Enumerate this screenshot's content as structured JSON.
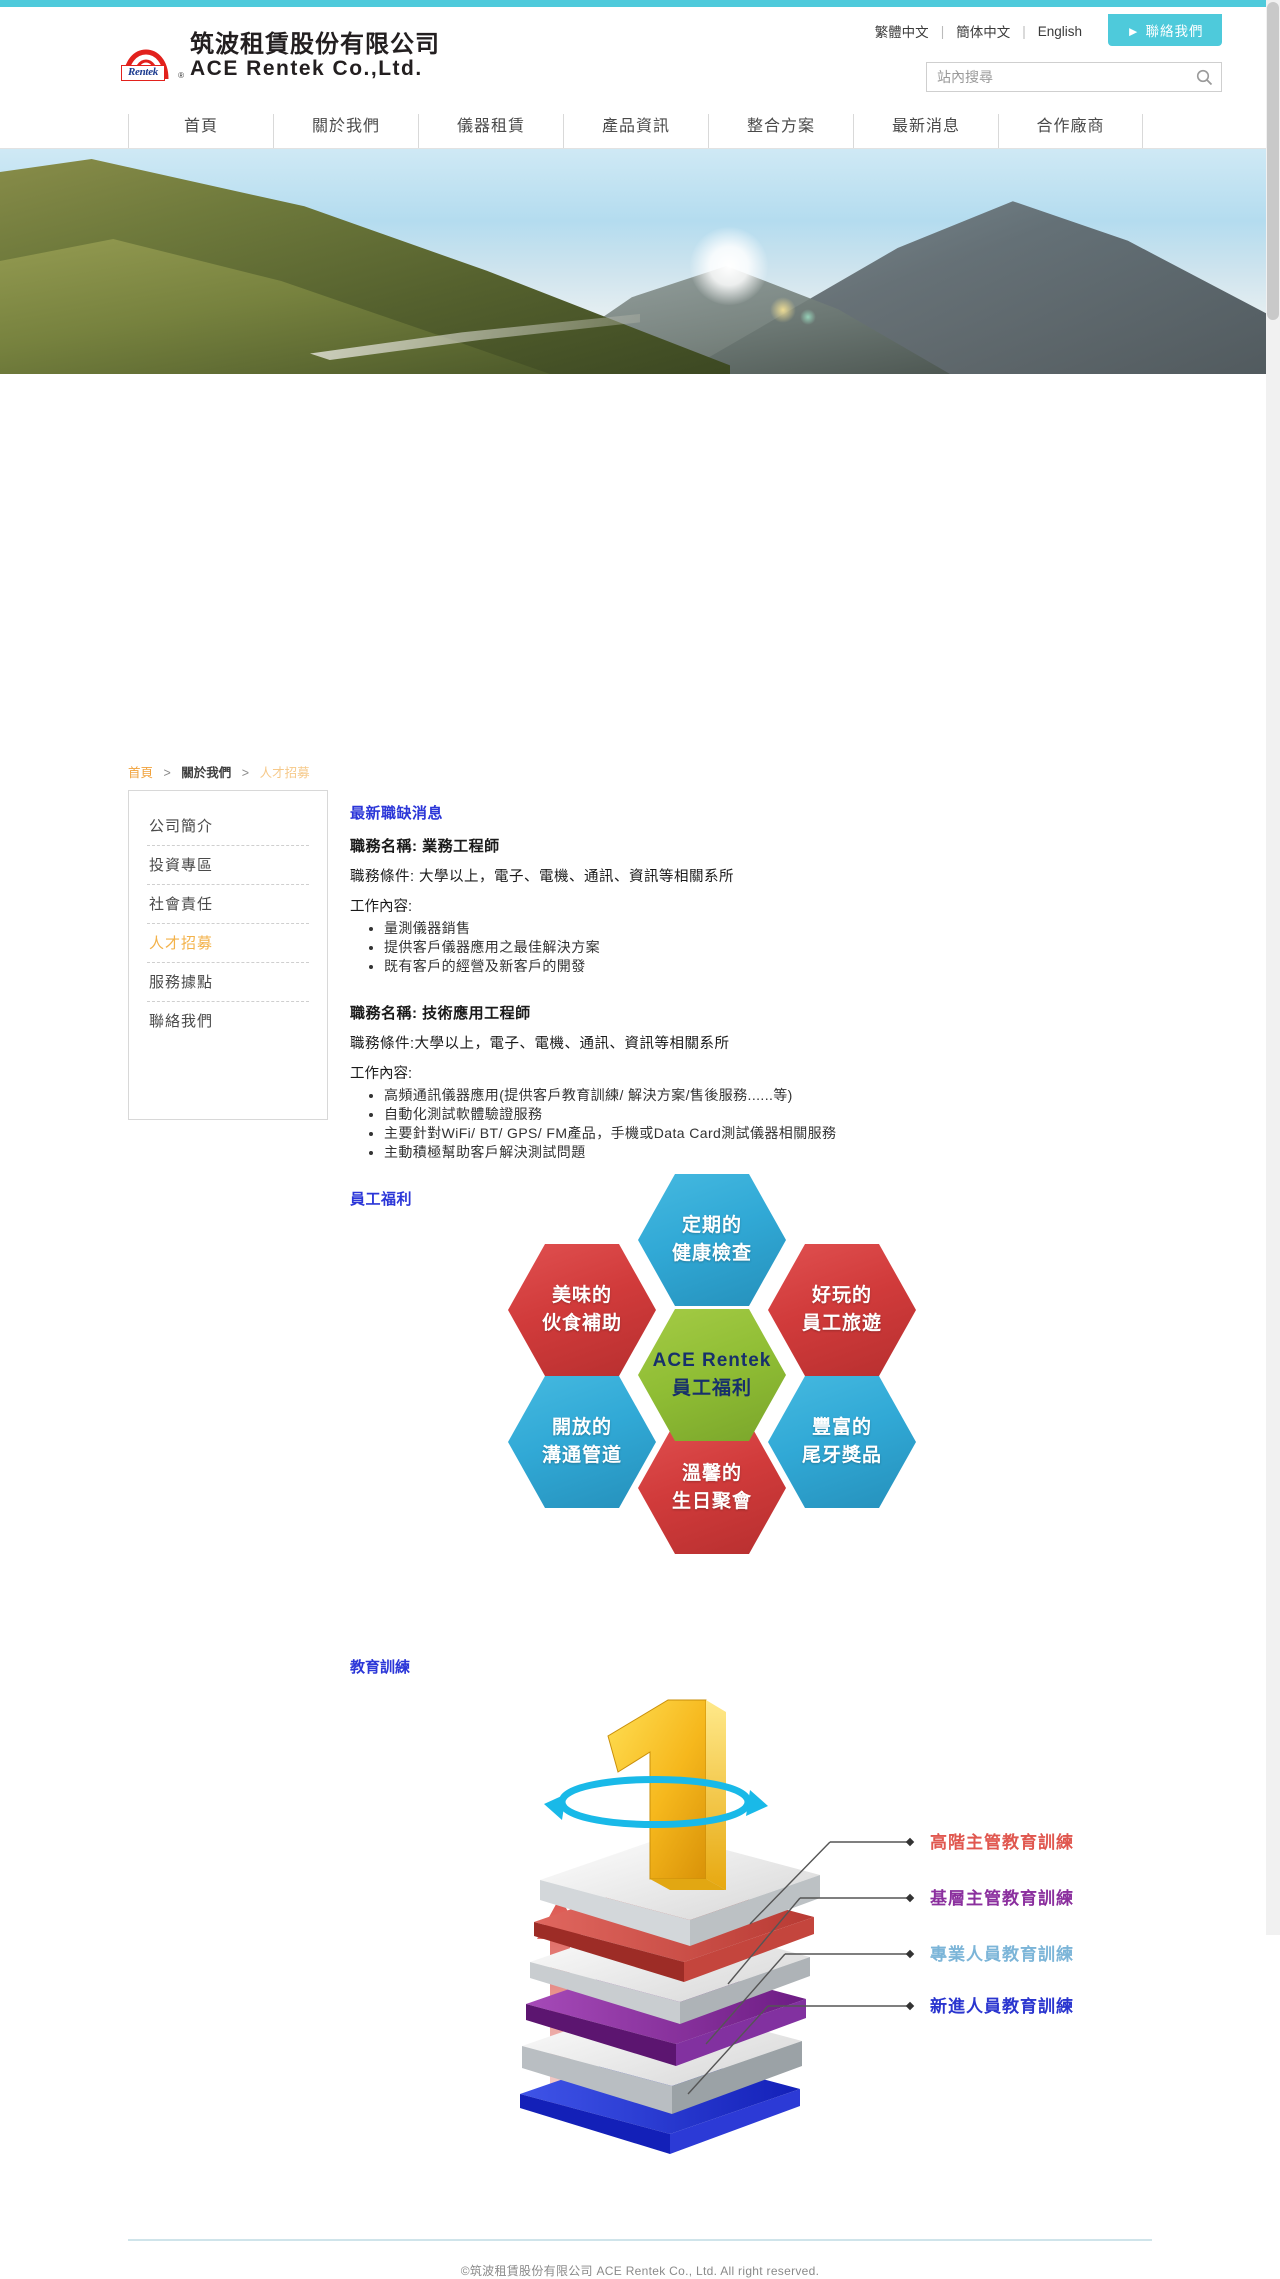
{
  "header": {
    "logo_cn": "筑波租賃股份有限公司",
    "logo_en": "ACE Rentek Co.,Ltd.",
    "logo_badge": "Rentek",
    "registered_mark": "®",
    "languages": [
      {
        "label": "繁體中文"
      },
      {
        "label": "簡体中文"
      },
      {
        "label": "English"
      }
    ],
    "lang_separator": "|",
    "contact_button": "► 聯絡我們",
    "search": {
      "placeholder": "站內搜尋",
      "value": "",
      "icon": "search-icon"
    }
  },
  "nav": {
    "items": [
      {
        "label": "首頁"
      },
      {
        "label": "關於我們"
      },
      {
        "label": "儀器租賃"
      },
      {
        "label": "產品資訊"
      },
      {
        "label": "整合方案"
      },
      {
        "label": "最新消息"
      },
      {
        "label": "合作廠商"
      }
    ]
  },
  "breadcrumb": {
    "home": "首頁",
    "sep": ">",
    "parent": "關於我們",
    "current": "人才招募"
  },
  "sidebar": {
    "items": [
      {
        "label": "公司簡介",
        "active": false
      },
      {
        "label": "投資專區",
        "active": false
      },
      {
        "label": "社會責任",
        "active": false
      },
      {
        "label": "人才招募",
        "active": true
      },
      {
        "label": "服務據點",
        "active": false
      },
      {
        "label": "聯絡我們",
        "active": false
      }
    ]
  },
  "main": {
    "jobs_section_title": "最新職缺消息",
    "jobs": [
      {
        "title": "職務名稱: 業務工程師",
        "requirement": "職務條件: 大學以上，電子、電機、通訊、資訊等相關系所",
        "duties_label": "工作內容:",
        "duties": [
          "量測儀器銷售",
          "提供客戶儀器應用之最佳解決方案",
          "既有客戶的經營及新客戶的開發"
        ]
      },
      {
        "title": "職務名稱: 技術應用工程師",
        "requirement": "職務條件:大學以上，電子、電機、通訊、資訊等相關系所",
        "duties_label": "工作內容:",
        "duties": [
          "高頻通訊儀器應用(提供客戶教育訓練/ 解決方案/售後服務......等)",
          "自動化測試軟體驗證服務",
          "主要針對WiFi/ BT/ GPS/ FM產品，手機或Data Card測試儀器相關服務",
          "主動積極幫助客戶解決測試問題"
        ]
      }
    ],
    "benefits_section_title": "員工福利",
    "benefits_diagram": {
      "center": {
        "line1": "ACE Rentek",
        "line2": "員工福利",
        "color": "#8fbd34"
      },
      "cells": [
        {
          "line1": "定期的",
          "line2": "健康檢查",
          "color": "#31a9d6",
          "position": "top"
        },
        {
          "line1": "好玩的",
          "line2": "員工旅遊",
          "color": "#d13b3b",
          "position": "top-right"
        },
        {
          "line1": "豐富的",
          "line2": "尾牙獎品",
          "color": "#31a9d6",
          "position": "bottom-right"
        },
        {
          "line1": "溫馨的",
          "line2": "生日聚會",
          "color": "#d13b3b",
          "position": "bottom"
        },
        {
          "line1": "開放的",
          "line2": "溝通管道",
          "color": "#31a9d6",
          "position": "bottom-left"
        },
        {
          "line1": "美味的",
          "line2": "伙食補助",
          "color": "#d13b3b",
          "position": "top-left"
        }
      ]
    },
    "training_section_title": "教育訓練",
    "training_diagram": {
      "levels": [
        {
          "label": "高階主管教育訓練",
          "color": "#e0574f"
        },
        {
          "label": "基層主管教育訓練",
          "color": "#8b2f9e"
        },
        {
          "label": "專業人員教育訓練",
          "color": "#7cb5d8"
        },
        {
          "label": "新進人員教育訓練",
          "color": "#2a35cf"
        }
      ],
      "trophy_numeral": "1"
    }
  },
  "footer": {
    "copyright": "©筑波租賃股份有限公司 ACE Rentek Co., Ltd. All right reserved."
  }
}
